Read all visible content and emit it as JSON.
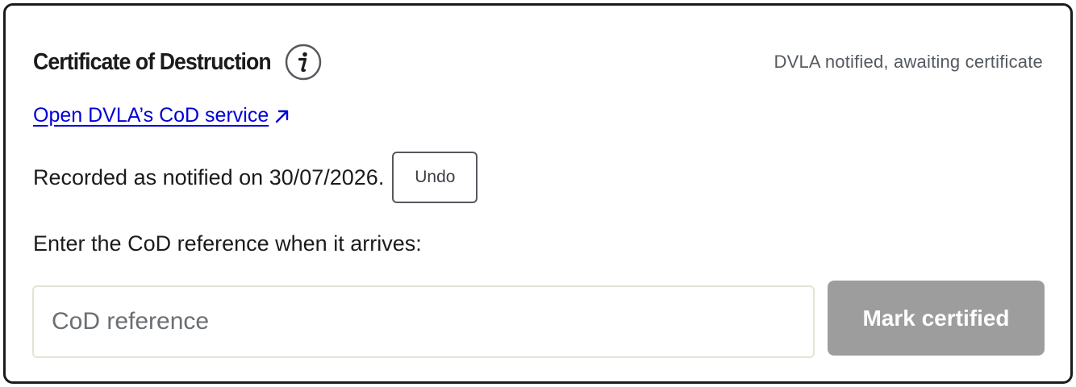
{
  "panel": {
    "title": "Certificate of Destruction",
    "status": "DVLA notified, awaiting certificate",
    "link_label": "Open DVLA’s CoD service",
    "recorded_text": "Recorded as notified on 30/07/2026.",
    "undo_label": "Undo",
    "prompt_text": "Enter the CoD reference when it arrives:",
    "reference_input": {
      "placeholder": "CoD reference",
      "value": ""
    },
    "submit_label": "Mark certified"
  },
  "icons": {
    "info": "info-icon",
    "external_link": "arrow-up-right-icon"
  },
  "colors": {
    "link": "#0000d6",
    "border": "#1b1b1b",
    "disabled_button": "#9d9d9d",
    "muted_text": "#555a60"
  }
}
